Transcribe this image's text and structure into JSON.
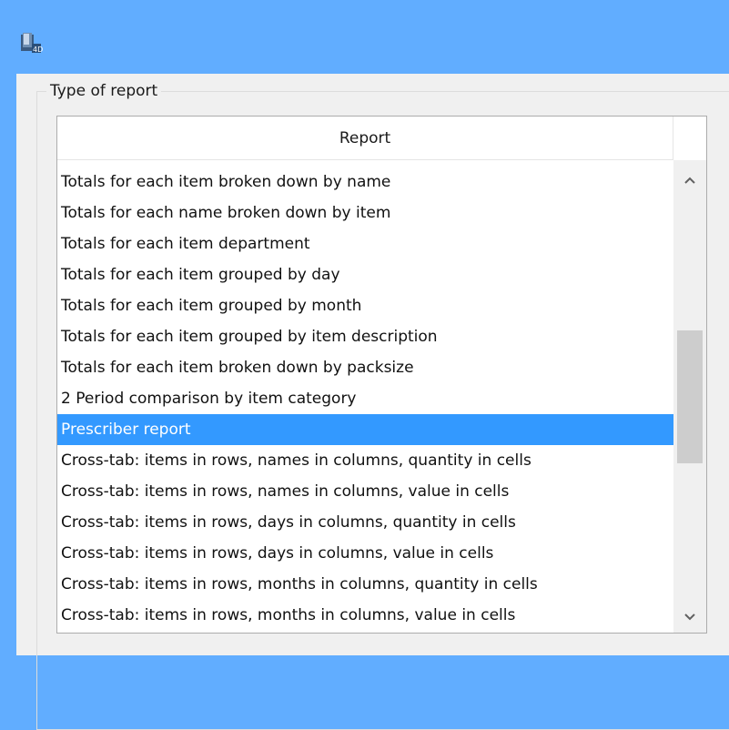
{
  "window": {
    "icon": "app-icon",
    "title": ""
  },
  "group": {
    "legend": "Type of report"
  },
  "list": {
    "column_header": "Report",
    "selected_index": 8,
    "items": [
      "Totals for each item broken down by name",
      "Totals for each name broken down by item",
      "Totals for each item department",
      "Totals for each item grouped by day",
      "Totals for each item grouped by month",
      "Totals for each item grouped by item description",
      "Totals for each item broken down by packsize",
      "2 Period comparison by item category",
      "Prescriber report",
      "Cross-tab: items in rows, names in columns, quantity in cells",
      "Cross-tab: items in rows, names in columns, value in cells",
      "Cross-tab: items in rows, days in columns, quantity in cells",
      "Cross-tab: items in rows, days in columns, value in cells",
      "Cross-tab: items in rows, months in columns, quantity in cells",
      "Cross-tab: items in rows, months in columns, value in cells"
    ]
  },
  "scrollbar": {
    "up_icon": "chevron-up-icon",
    "down_icon": "chevron-down-icon"
  },
  "colors": {
    "titlebar": "#61adff",
    "selection": "#3399ff"
  }
}
